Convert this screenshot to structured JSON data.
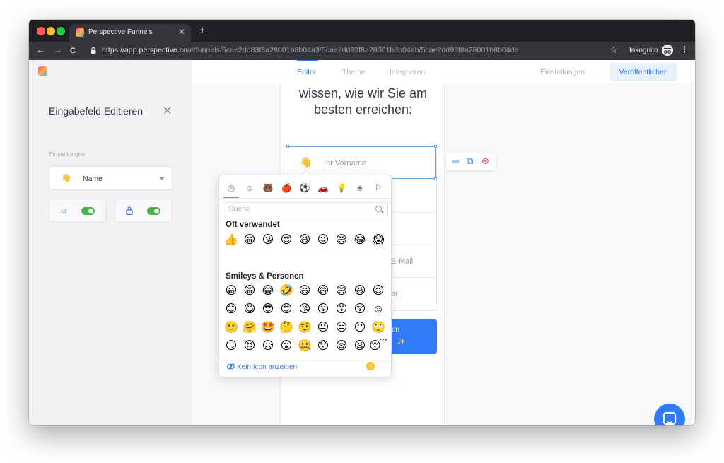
{
  "browser": {
    "tab_title": "Perspective Funnels",
    "tab_close": "✕",
    "new_tab": "+",
    "url_host": "https://app.perspective.co",
    "url_path": "/#/funnels/5cae2dd83f8a28001b8b04a3/5cae2dd93f8a28001b8b04ab/5cae2dd93f8a28001b8b04de",
    "star": "☆",
    "incognito_label": "Inkognito",
    "menu": "⋮",
    "back": "←",
    "forward": "→",
    "reload": "C"
  },
  "sidebar": {
    "title": "Eingabefeld Editieren",
    "close": "✕",
    "section_label": "Einstellungen",
    "icon_select": {
      "emoji": "👋",
      "label": "Name"
    },
    "toggle_emoji": {
      "icon": "☺",
      "on": true
    },
    "toggle_required": {
      "icon": "🔒",
      "on": true
    }
  },
  "topnav": {
    "tabs": [
      {
        "label": "Editor",
        "active": true
      },
      {
        "label": "Theme",
        "active": false
      },
      {
        "label": "Integrieren",
        "active": false
      }
    ],
    "settings": "Einstellungen",
    "publish": "Veröffentlichen"
  },
  "canvas": {
    "headline_1": "wissen, wie wir Sie am",
    "headline_2": "besten erreichen:",
    "field_emoji": "👋",
    "field_placeholder": "Ihr Vorname",
    "row_email_partial": "E-Mail",
    "row_phone_partial": "er",
    "submit_partial": "en",
    "submit_sparkle": "✨"
  },
  "field_actions": {
    "move": "═",
    "copy": "⧉",
    "delete": "⊖"
  },
  "emoji_picker": {
    "categories": [
      {
        "name": "recent",
        "glyph": "◷"
      },
      {
        "name": "smileys",
        "glyph": "☺"
      },
      {
        "name": "animals",
        "glyph": "🐻"
      },
      {
        "name": "food",
        "glyph": "🍎"
      },
      {
        "name": "activity",
        "glyph": "⚽"
      },
      {
        "name": "travel",
        "glyph": "🚗"
      },
      {
        "name": "objects",
        "glyph": "💡"
      },
      {
        "name": "symbols",
        "glyph": "♣"
      },
      {
        "name": "flags",
        "glyph": "⚐"
      }
    ],
    "search_placeholder": "Suche",
    "frequent_label": "Oft verwendet",
    "frequent": [
      "👍",
      "😀",
      "😘",
      "😍",
      "😆",
      "😜",
      "😅",
      "😂",
      "😱"
    ],
    "smileys_label": "Smileys & Personen",
    "smileys": [
      "😀",
      "😁",
      "😂",
      "🤣",
      "😃",
      "😄",
      "😅",
      "😆",
      "😉",
      "😊",
      "😋",
      "😎",
      "😍",
      "😘",
      "😗",
      "😙",
      "😚",
      "☺",
      "🙂",
      "🤗",
      "🤩",
      "🤔",
      "🤨",
      "😐",
      "😑",
      "😶",
      "🙄",
      "😏",
      "😣",
      "😥",
      "😮",
      "🤐",
      "😯",
      "😪",
      "😫",
      "😴"
    ],
    "no_icon_label": "Kein Icon anzeigen",
    "skin_tone": "#ffc93b"
  },
  "colors": {
    "accent": "#2f7cf6",
    "toggle_on": "#4caf50"
  }
}
